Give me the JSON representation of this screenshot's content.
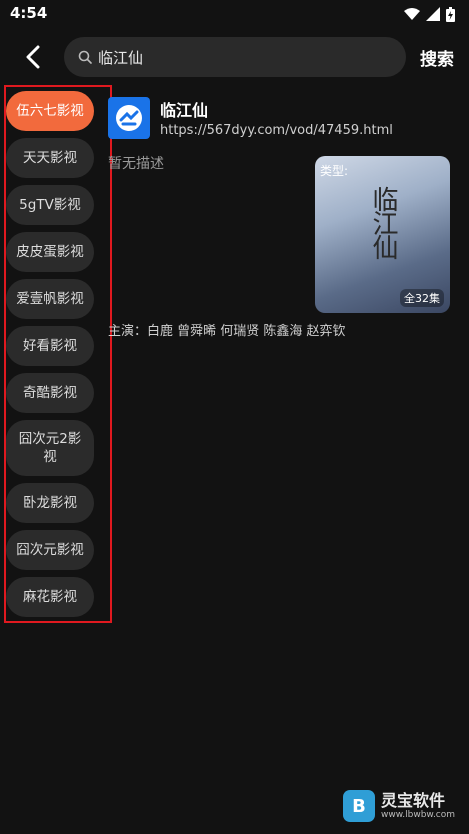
{
  "status": {
    "time": "4:54"
  },
  "search": {
    "query": "临江仙",
    "button": "搜索"
  },
  "sidebar": {
    "items": [
      {
        "label": "伍六七影视",
        "active": true
      },
      {
        "label": "天天影视"
      },
      {
        "label": "5gTV影视"
      },
      {
        "label": "皮皮蛋影视"
      },
      {
        "label": "爱壹帆影视"
      },
      {
        "label": "好看影视"
      },
      {
        "label": "奇酷影视"
      },
      {
        "label": "囧次元2影视"
      },
      {
        "label": "卧龙影视"
      },
      {
        "label": "囧次元影视"
      },
      {
        "label": "麻花影视"
      }
    ]
  },
  "result": {
    "title": "临江仙",
    "url": "https://567dyy.com/vod/47459.html",
    "description": "暂无描述",
    "poster_type": "类型:",
    "poster_title": "临江仙",
    "episodes": "全32集",
    "cast": "主演：白鹿 曾舜晞 何瑞贤 陈鑫海 赵弈钦"
  },
  "watermark": {
    "name": "灵宝软件",
    "url": "www.lbwbw.com"
  }
}
